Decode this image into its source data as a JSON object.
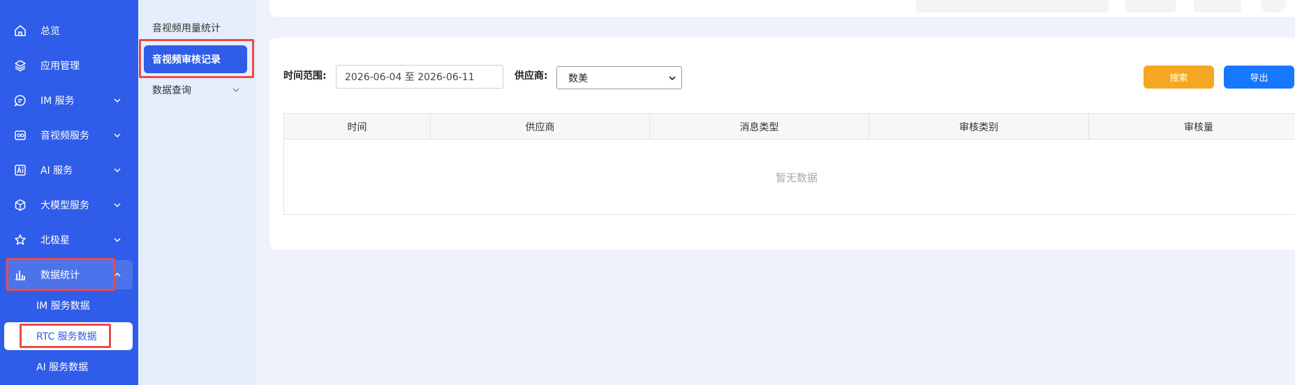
{
  "sidebar": {
    "items": [
      {
        "label": "总览",
        "icon": "home-icon"
      },
      {
        "label": "应用管理",
        "icon": "layers-icon"
      },
      {
        "label": "IM 服务",
        "icon": "chat-icon"
      },
      {
        "label": "音视频服务",
        "icon": "video-icon"
      },
      {
        "label": "AI 服务",
        "icon": "ai-icon"
      },
      {
        "label": "大模型服务",
        "icon": "cube-icon"
      },
      {
        "label": "北极星",
        "icon": "star-icon"
      },
      {
        "label": "数据统计",
        "icon": "bar-chart-icon"
      }
    ],
    "sub_items": [
      {
        "label": "IM 服务数据"
      },
      {
        "label": "RTC 服务数据"
      },
      {
        "label": "AI 服务数据"
      }
    ]
  },
  "subnav": {
    "items": [
      {
        "label": "音视频用量统计"
      },
      {
        "label": "音视频审核记录"
      },
      {
        "label": "数据查询"
      }
    ]
  },
  "filters": {
    "time_range_label": "时间范围:",
    "time_range_value": "2026-06-04 至 2026-06-11",
    "vendor_label": "供应商:",
    "vendor_value": "数美",
    "search_button": "搜索",
    "export_button": "导出"
  },
  "table": {
    "columns": [
      "时间",
      "供应商",
      "消息类型",
      "审核类别",
      "审核量"
    ],
    "empty_text": "暂无数据"
  },
  "colors": {
    "sidebar_bg": "#2f5ce8",
    "search_button": "#f5a623",
    "export_button": "#1677ff",
    "highlight": "#e94b4b"
  }
}
